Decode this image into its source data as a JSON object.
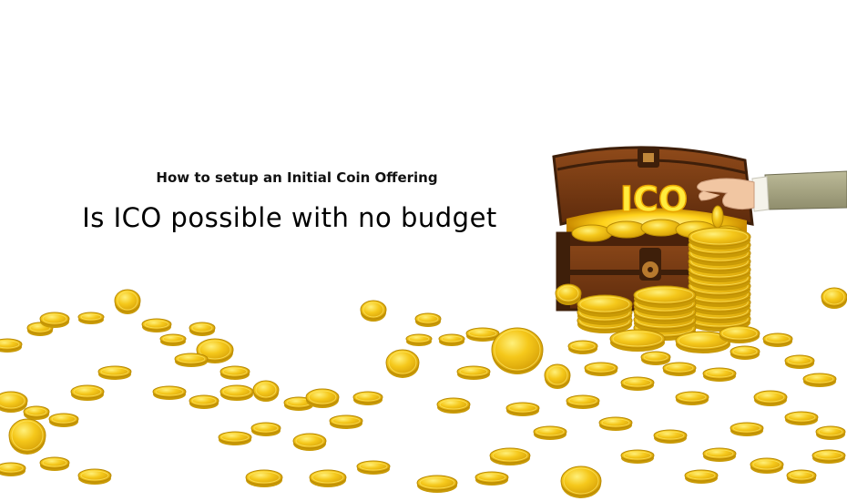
{
  "header": {
    "subtitle": "How to setup an Initial Coin Offering",
    "title": "Is ICO possible with no budget"
  },
  "illustration": {
    "chest_label": "ICO",
    "icons": [
      "treasure-chest-icon",
      "hand-icon",
      "coin-icon"
    ]
  },
  "colors": {
    "background": "#ffffff",
    "coin": "#f2c318",
    "coin_edge": "#c99a06",
    "coin_highlight": "#ffe866",
    "chest_wood": "#7a3b12",
    "chest_trim": "#3e1f0a",
    "glow": "#ffd21a",
    "sleeve": "#a9a784",
    "skin": "#f1c6a2"
  }
}
